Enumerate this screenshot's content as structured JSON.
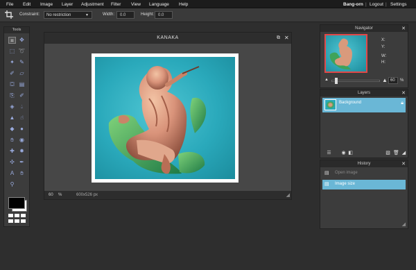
{
  "menubar": {
    "items": [
      "File",
      "Edit",
      "Image",
      "Layer",
      "Adjustment",
      "Filter",
      "View",
      "Language",
      "Help"
    ],
    "user": "Bang-orn",
    "logout": "Logout",
    "settings": "Settings",
    "separator": "|"
  },
  "options": {
    "constraint_label": "Constraint:",
    "constraint_value": "No restriction",
    "width_label": "Width:",
    "width_value": "0.0",
    "height_label": "Height:",
    "height_value": "0.0"
  },
  "tools": {
    "title": "Tools",
    "icons": [
      "crop-icon",
      "move-icon",
      "marquee-icon",
      "lasso-icon",
      "wand-icon",
      "pencil-icon",
      "brush-icon",
      "eraser-icon",
      "bucket-icon",
      "gradient-icon",
      "clone-icon",
      "color-replace-icon",
      "drawing-icon",
      "blur-icon",
      "sharpen-icon",
      "smudge-icon",
      "sponge-icon",
      "dodge-icon",
      "burn-icon",
      "redeye-icon",
      "spot-heal-icon",
      "bloat-icon",
      "pinch-icon",
      "colorpicker-icon",
      "type-icon",
      "hand-icon",
      "zoom-icon"
    ],
    "colors": {
      "primary": "#000000",
      "secondary": "#ffffff"
    }
  },
  "document": {
    "title": "KANAKA",
    "zoom": "60",
    "zoom_unit": "%",
    "size": "600x526 px"
  },
  "navigator": {
    "title": "Navigator",
    "x_label": "X:",
    "y_label": "Y:",
    "w_label": "W:",
    "h_label": "H:",
    "zoom": "60",
    "zoom_unit": "%"
  },
  "layers": {
    "title": "Layers",
    "items": [
      {
        "name": "Background"
      }
    ]
  },
  "history": {
    "title": "History",
    "items": [
      {
        "label": "Open image"
      },
      {
        "label": "Image size"
      }
    ]
  },
  "colors": {
    "accent": "#6ab7d6",
    "image_bg": "#2aa9bb",
    "statue": "#d99a7c",
    "moss": "#3fa35a"
  }
}
